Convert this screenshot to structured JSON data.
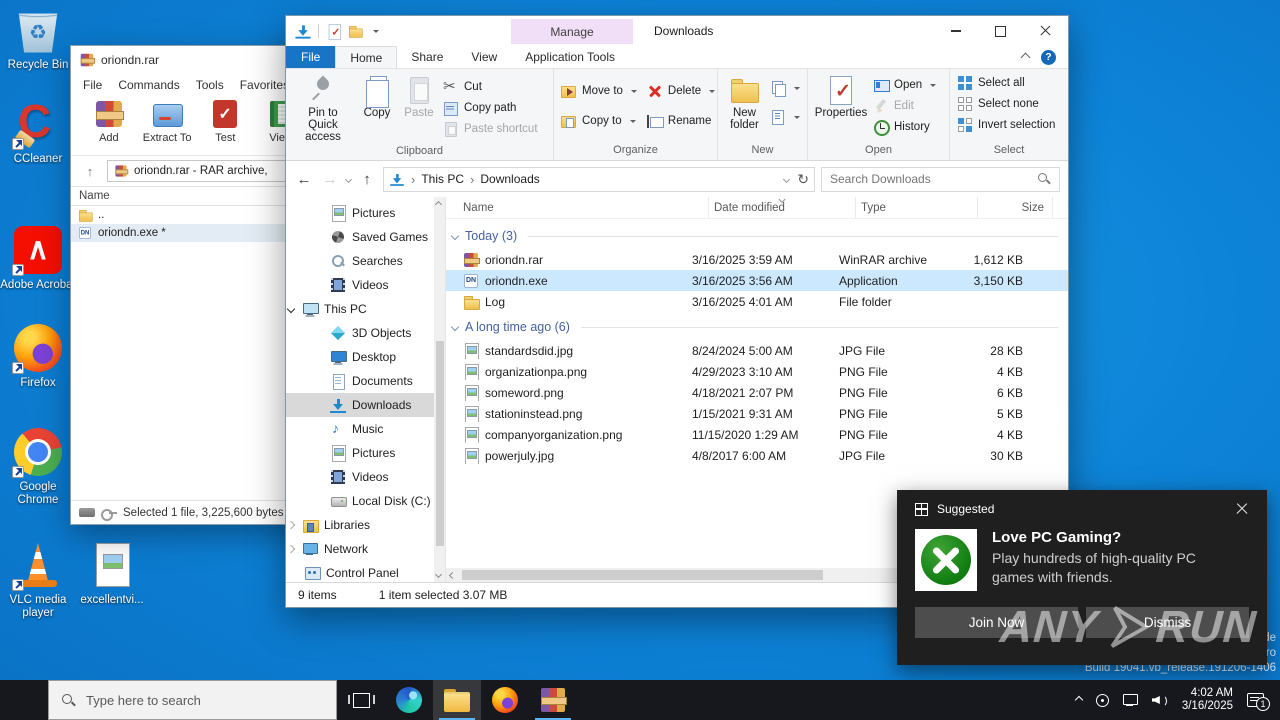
{
  "desktop": {
    "icons": [
      {
        "id": "recycle",
        "label": "Recycle Bin",
        "shortcut": false
      },
      {
        "id": "ccleaner",
        "label": "CCleaner",
        "shortcut": true
      },
      {
        "id": "adobe",
        "label": "Adobe Acrobat",
        "shortcut": true
      },
      {
        "id": "firefox",
        "label": "Firefox",
        "shortcut": true
      },
      {
        "id": "chrome",
        "label": "Google Chrome",
        "shortcut": true
      },
      {
        "id": "vlc",
        "label": "VLC media player",
        "shortcut": true
      },
      {
        "id": "excellent",
        "label": "excellentvi...",
        "shortcut": false
      }
    ],
    "watermark_line1": "de",
    "watermark_line2": "ro",
    "build_text": "Build 19041.vb_release.191206-1406",
    "anyrun_left": "ANY",
    "anyrun_right": "RUN"
  },
  "winrar": {
    "title": "oriondn.rar",
    "menus": [
      "File",
      "Commands",
      "Tools",
      "Favorites"
    ],
    "toolbar": [
      "Add",
      "Extract To",
      "Test",
      "View"
    ],
    "address": "oriondn.rar - RAR archive,",
    "column_header": "Name",
    "rows": [
      {
        "name": "..",
        "icon": "folder",
        "selected": false
      },
      {
        "name": "oriondn.exe *",
        "icon": "exe",
        "selected": true
      }
    ],
    "status": "Selected 1 file, 3,225,600 bytes"
  },
  "explorer": {
    "title": "Downloads",
    "contextual_group": "Manage",
    "tabs": [
      "File",
      "Home",
      "Share",
      "View",
      "Application Tools"
    ],
    "help": "?",
    "ribbon": {
      "clipboard": {
        "label": "Clipboard",
        "buttons": [
          "Pin to Quick access",
          "Copy",
          "Paste",
          "Cut",
          "Copy path",
          "Paste shortcut"
        ]
      },
      "organize": {
        "label": "Organize",
        "buttons": [
          "Move to",
          "Copy to",
          "Delete",
          "Rename"
        ]
      },
      "new": {
        "label": "New",
        "buttons": [
          "New folder"
        ]
      },
      "open": {
        "label": "Open",
        "buttons": [
          "Properties",
          "Open",
          "Edit",
          "History"
        ]
      },
      "select": {
        "label": "Select",
        "buttons": [
          "Select all",
          "Select none",
          "Invert selection"
        ]
      }
    },
    "address": {
      "crumb1": "This PC",
      "crumb2": "Downloads"
    },
    "search_placeholder": "Search Downloads",
    "nav": [
      {
        "label": "Pictures",
        "icon": "img",
        "depth": 1
      },
      {
        "label": "Saved Games",
        "icon": "pinwheel",
        "depth": 1
      },
      {
        "label": "Searches",
        "icon": "magnifier",
        "depth": 1
      },
      {
        "label": "Videos",
        "icon": "film",
        "depth": 1
      },
      {
        "label": "This PC",
        "icon": "pc",
        "depth": 0,
        "expander": "open"
      },
      {
        "label": "3D Objects",
        "icon": "cube",
        "depth": 1
      },
      {
        "label": "Desktop",
        "icon": "monitor",
        "depth": 1
      },
      {
        "label": "Documents",
        "icon": "doc",
        "depth": 1
      },
      {
        "label": "Downloads",
        "icon": "dl",
        "depth": 1,
        "selected": true
      },
      {
        "label": "Music",
        "icon": "note",
        "depth": 1
      },
      {
        "label": "Pictures",
        "icon": "img",
        "depth": 1
      },
      {
        "label": "Videos",
        "icon": "film",
        "depth": 1
      },
      {
        "label": "Local Disk (C:)",
        "icon": "disk",
        "depth": 1
      },
      {
        "label": "Libraries",
        "icon": "lib",
        "depth": 0,
        "expander": "closed"
      },
      {
        "label": "Network",
        "icon": "net",
        "depth": 0,
        "expander": "closed"
      },
      {
        "label": "Control Panel",
        "icon": "ctrl",
        "depth": 0
      }
    ],
    "columns": {
      "name": "Name",
      "date": "Date modified",
      "type": "Type",
      "size": "Size"
    },
    "groups": [
      {
        "label": "Today (3)",
        "files": [
          {
            "name": "oriondn.rar",
            "date": "3/16/2025 3:59 AM",
            "type": "WinRAR archive",
            "size": "1,612 KB",
            "icon": "rar"
          },
          {
            "name": "oriondn.exe",
            "date": "3/16/2025 3:56 AM",
            "type": "Application",
            "size": "3,150 KB",
            "icon": "exe",
            "selected": true
          },
          {
            "name": "Log",
            "date": "3/16/2025 4:01 AM",
            "type": "File folder",
            "size": "",
            "icon": "folder"
          }
        ]
      },
      {
        "label": "A long time ago (6)",
        "files": [
          {
            "name": "standardsdid.jpg",
            "date": "8/24/2024 5:00 AM",
            "type": "JPG File",
            "size": "28 KB",
            "icon": "img"
          },
          {
            "name": "organizationpa.png",
            "date": "4/29/2023 3:10 AM",
            "type": "PNG File",
            "size": "4 KB",
            "icon": "img"
          },
          {
            "name": "someword.png",
            "date": "4/18/2021 2:07 PM",
            "type": "PNG File",
            "size": "6 KB",
            "icon": "img"
          },
          {
            "name": "stationinstead.png",
            "date": "1/15/2021 9:31 AM",
            "type": "PNG File",
            "size": "5 KB",
            "icon": "img"
          },
          {
            "name": "companyorganization.png",
            "date": "11/15/2020 1:29 AM",
            "type": "PNG File",
            "size": "4 KB",
            "icon": "img"
          },
          {
            "name": "powerjuly.jpg",
            "date": "4/8/2017 6:00 AM",
            "type": "JPG File",
            "size": "30 KB",
            "icon": "img"
          }
        ]
      }
    ],
    "status_items": "9 items",
    "status_selected": "1 item selected 3.07 MB"
  },
  "toast": {
    "header": "Suggested",
    "title": "Love PC Gaming?",
    "line1": "Play hundreds of high-quality PC",
    "line2": "games with friends.",
    "join_label": "Join Now",
    "dismiss_label": "Dismiss"
  },
  "taskbar": {
    "search_placeholder": "Type here to search",
    "time": "4:02 AM",
    "date": "3/16/2025",
    "badge": "1"
  }
}
